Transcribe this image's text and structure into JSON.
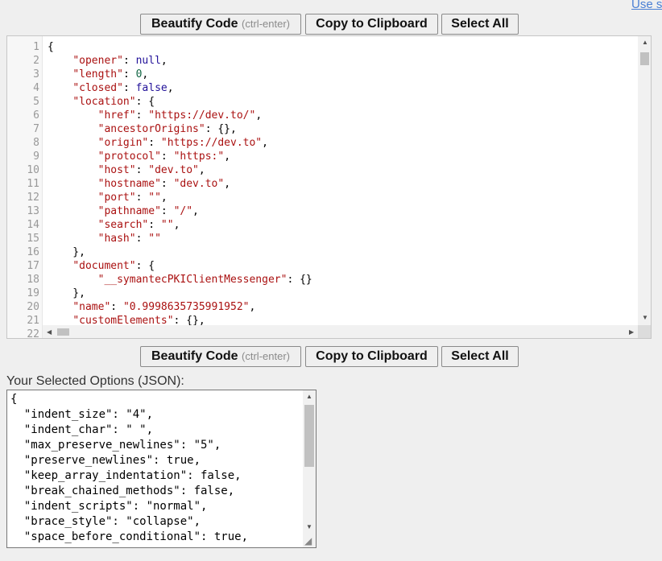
{
  "top_link": "Use s",
  "toolbar": {
    "beautify_label": "Beautify Code",
    "beautify_hint": "(ctrl-enter)",
    "copy_label": "Copy to Clipboard",
    "select_all_label": "Select All"
  },
  "editor": {
    "line_numbers": [
      "1",
      "2",
      "3",
      "4",
      "5",
      "6",
      "7",
      "8",
      "9",
      "10",
      "11",
      "12",
      "13",
      "14",
      "15",
      "16",
      "17",
      "18",
      "19",
      "20",
      "21",
      "22"
    ],
    "lines": [
      "{",
      "    \"opener\": null,",
      "    \"length\": 0,",
      "    \"closed\": false,",
      "    \"location\": {",
      "        \"href\": \"https://dev.to/\",",
      "        \"ancestorOrigins\": {},",
      "        \"origin\": \"https://dev.to\",",
      "        \"protocol\": \"https:\",",
      "        \"host\": \"dev.to\",",
      "        \"hostname\": \"dev.to\",",
      "        \"port\": \"\",",
      "        \"pathname\": \"/\",",
      "        \"search\": \"\",",
      "        \"hash\": \"\"",
      "    },",
      "    \"document\": {",
      "        \"__symantecPKIClientMessenger\": {}",
      "    },",
      "    \"name\": \"0.9998635735991952\",",
      "    \"customElements\": {},",
      ""
    ]
  },
  "options": {
    "label": "Your Selected Options (JSON):",
    "lines": [
      "{",
      "  \"indent_size\": \"4\",",
      "  \"indent_char\": \" \",",
      "  \"max_preserve_newlines\": \"5\",",
      "  \"preserve_newlines\": true,",
      "  \"keep_array_indentation\": false,",
      "  \"break_chained_methods\": false,",
      "  \"indent_scripts\": \"normal\",",
      "  \"brace_style\": \"collapse\",",
      "  \"space_before_conditional\": true,"
    ]
  },
  "icons": {
    "scroll_up": "▲",
    "scroll_down": "▼",
    "scroll_left": "◀",
    "scroll_right": "▶",
    "resize": "◢"
  },
  "colors": {
    "key": "#aa1111",
    "atom": "#221199",
    "number": "#116644",
    "line_number": "#999999"
  }
}
